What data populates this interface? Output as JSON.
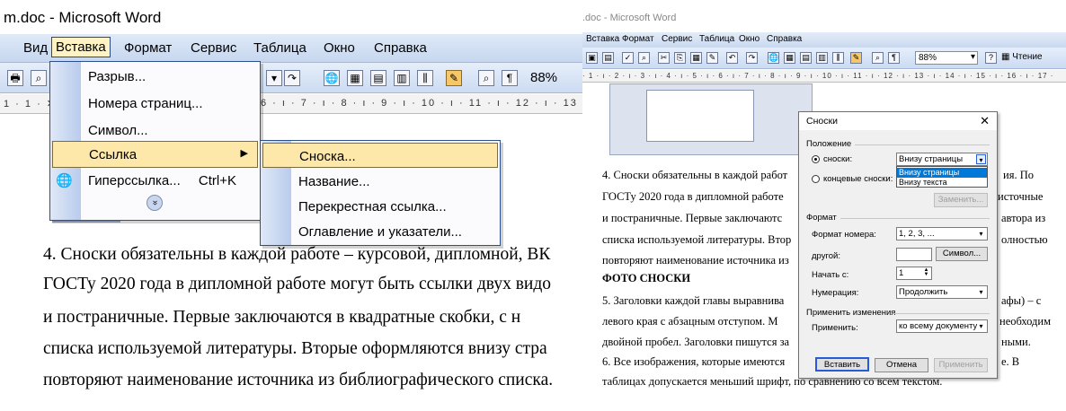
{
  "left": {
    "window_title": "m.doc - Microsoft Word",
    "menu": [
      "Вид",
      "Вставка",
      "Формат",
      "Сервис",
      "Таблица",
      "Окно",
      "Справка"
    ],
    "zoom": "88%",
    "ruler": "1 · 1 · ✕",
    "ruler_right": "6 · ı · 7 · ı · 8 · ı · 9 · ı · 10 · ı · 11 · ı · 12 · ı · 13 · ı · 14",
    "insert_menu": {
      "items": [
        {
          "label": "Разрыв..."
        },
        {
          "label": "Номера страниц..."
        },
        {
          "label": "Символ..."
        },
        {
          "label": "Ссылка"
        },
        {
          "label": "Гиперссылка...",
          "shortcut": "Ctrl+K"
        }
      ],
      "more": "»"
    },
    "ref_submenu": [
      "Сноска...",
      "Название...",
      "Перекрестная ссылка...",
      "Оглавление и указатели..."
    ],
    "paragraph": [
      "4.  Сноски обязательны в каждой работе – курсовой, дипломной, ВК",
      "ГОСТу 2020 года в дипломной работе могут быть ссылки двух видо",
      "и  постраничные.  Первые  заключаются  в  квадратные  скобки,  с  н",
      "списка используемой литературы. Вторые оформляются внизу стра",
      "повторяют наименование источника из библиографического списка."
    ]
  },
  "right": {
    "window_title": ".doc - Microsoft Word",
    "menu": [
      "Вставка",
      "Формат",
      "Сервис",
      "Таблица",
      "Окно",
      "Справка"
    ],
    "zoom": "88%",
    "read_button": "Чтение",
    "ruler": "· 1 · ı · 2 · ı · 3 · ı · 4 · ı · 5 · ı · 6 · ı · 7 · ı · 8 · ı · 9 · ı · 10 · ı · 11 · ı · 12 · ı · 13 · ı · 14 · ı · 15 · ı · 16 · ı · 17 ·",
    "paragraphs": [
      "4.  Сноски обязательны в каждой работ",
      "ГОСТу 2020 года в дипломной работе",
      "и  постраничные.  Первые  заключаютс",
      "списка используемой литературы. Втор",
      "повторяют наименование источника из",
      "ФОТО СНОСКИ",
      "5.  Заголовки каждой главы выравнива",
      "левого  края  с  абзацным  отступом.  М",
      "двойной пробел. Заголовки пишутся за",
      "6.  Все изображения, которые имеются",
      "таблицах допускается меньший шрифт, по сравнению со всем текстом."
    ],
    "right_edge_text": [
      "ия. По",
      "источные",
      "автора из",
      "олностью",
      "афы) – с",
      "необходим",
      "ными.",
      "е. В"
    ],
    "dialog": {
      "title": "Сноски",
      "group_position": "Положение",
      "radio_footnotes": "сноски:",
      "radio_endnotes": "концевые сноски:",
      "position_value": "Внизу страницы",
      "position_options": [
        "Внизу страницы",
        "Внизу текста"
      ],
      "convert_button": "Заменить...",
      "group_format": "Формат",
      "number_format_label": "Формат номера:",
      "number_format_value": "1, 2, 3, ...",
      "custom_label": "другой:",
      "symbol_button": "Символ...",
      "start_label": "Начать с:",
      "start_value": "1",
      "numbering_label": "Нумерация:",
      "numbering_value": "Продолжить",
      "group_apply": "Применить изменения",
      "apply_label": "Применить:",
      "apply_value": "ко всему документу",
      "insert_button": "Вставить",
      "cancel_button": "Отмена",
      "apply_button": "Применить"
    }
  },
  "colors": {
    "menu_highlight": "#fde7a9",
    "menu_strip": "#b9cced",
    "dialog_accent": "#2a5bd7",
    "list_selection": "#0078d7"
  }
}
